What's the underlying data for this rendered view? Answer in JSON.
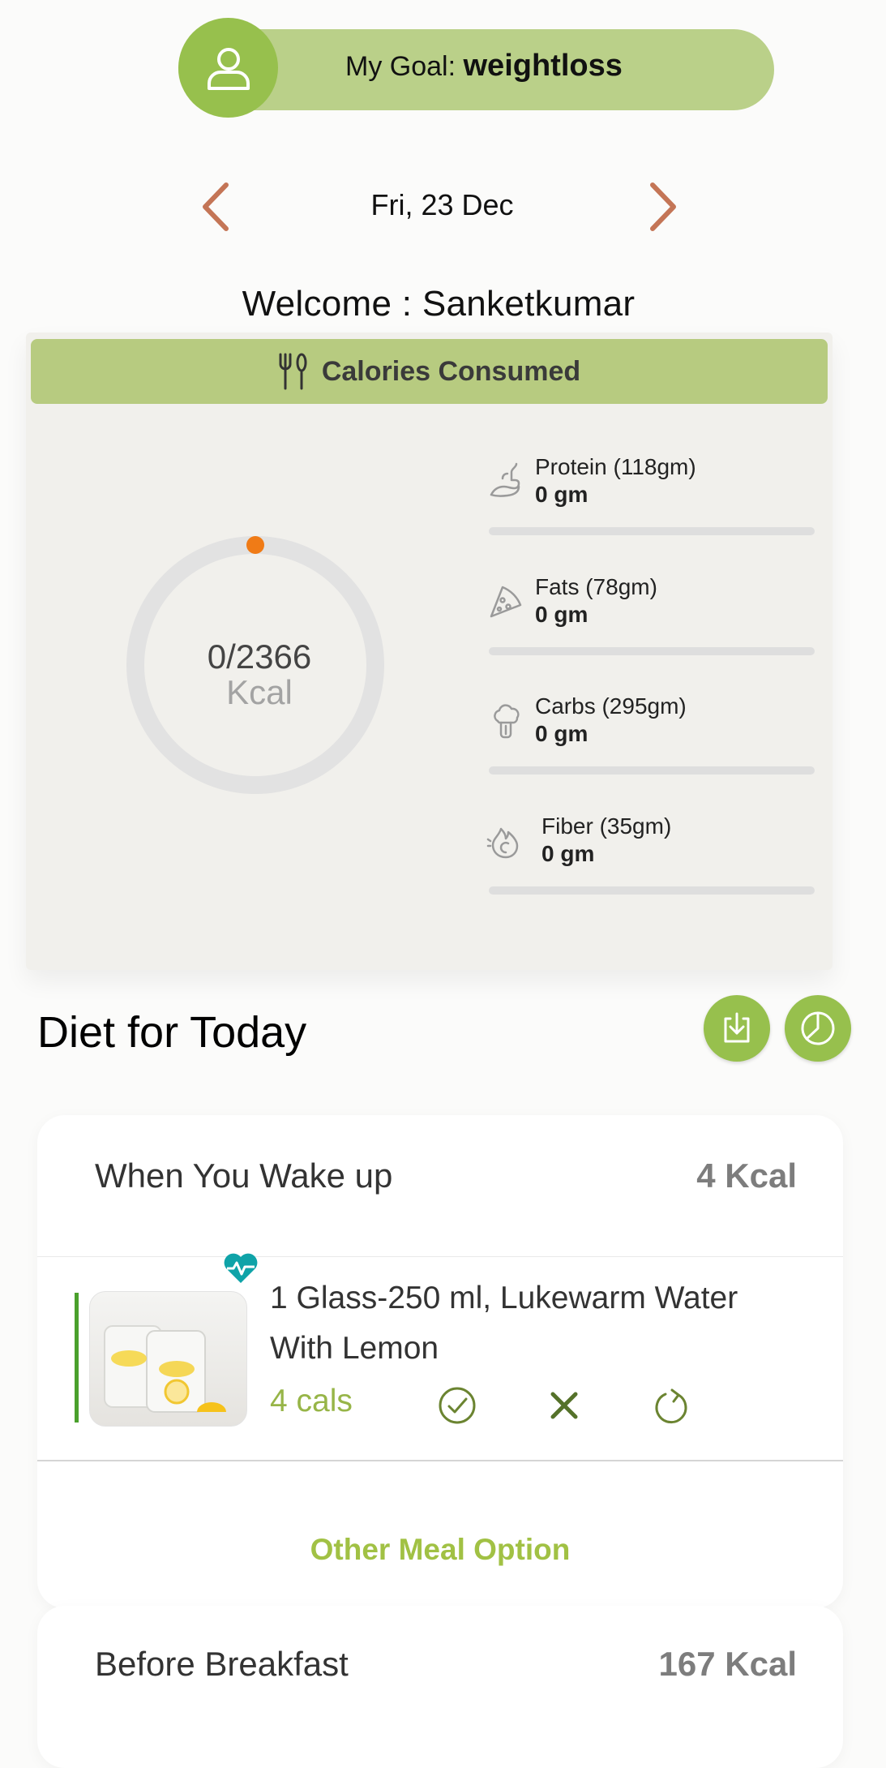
{
  "goal": {
    "prefix": "My Goal:",
    "value": "weightloss",
    "avatar_icon": "user-icon"
  },
  "date_nav": {
    "date": "Fri, 23 Dec",
    "prev_icon": "chevron-left-icon",
    "next_icon": "chevron-right-icon"
  },
  "welcome": "Welcome : Sanketkumar",
  "calories": {
    "header": "Calories Consumed",
    "header_icon": "fork-knife-icon",
    "consumed_text": "0/2366",
    "unit": "Kcal",
    "consumed": 0,
    "target": 2366,
    "macros": [
      {
        "label": "Protein (118gm)",
        "value": "0 gm",
        "icon": "muscle-arm-icon",
        "progress": 0
      },
      {
        "label": "Fats (78gm)",
        "value": "0 gm",
        "icon": "pizza-slice-icon",
        "progress": 0
      },
      {
        "label": "Carbs (295gm)",
        "value": "0 gm",
        "icon": "broccoli-icon",
        "progress": 0
      },
      {
        "label": "Fiber (35gm)",
        "value": "0 gm",
        "icon": "fiber-swirl-icon",
        "progress": 0
      }
    ]
  },
  "diet": {
    "title": "Diet for Today",
    "download_icon": "download-icon",
    "chart_icon": "pie-chart-icon",
    "meals": [
      {
        "name": "When You Wake up",
        "kcal": "4 Kcal",
        "item": {
          "text": "1 Glass-250 ml, Lukewarm Water With Lemon",
          "cals": "4 cals",
          "badge_icon": "heart-pulse-icon"
        },
        "other_option": "Other Meal Option"
      },
      {
        "name": "Before Breakfast",
        "kcal": "167 Kcal"
      }
    ]
  },
  "colors": {
    "brand_green": "#97c04d",
    "pill_green": "#bad089",
    "arrow_orange": "#c47556",
    "ring_dot": "#f07b16",
    "teal_badge": "#0fa3a8"
  }
}
